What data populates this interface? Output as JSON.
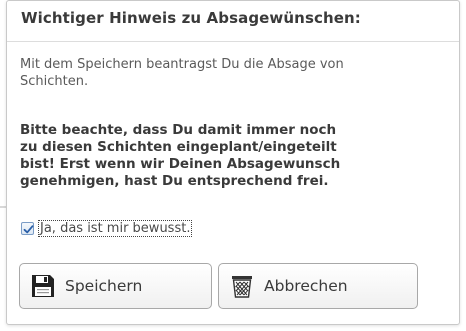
{
  "dialog": {
    "title": "Wichtiger Hinweis zu Absagewünschen:",
    "intro_line1": "Mit dem Speichern beantragst Du die Absage von",
    "intro_line2": "Schichten.",
    "warning_line1": "Bitte beachte, dass Du damit immer noch",
    "warning_line2": "zu diesen Schichten eingeplant/eingeteilt",
    "warning_line3": "bist! Erst wenn wir Deinen Absagewunsch",
    "warning_line4": "genehmigen, hast Du entsprechend frei.",
    "checkbox_label": "Ja, das ist mir bewusst.",
    "checkbox_checked": true,
    "save_label": "Speichern",
    "cancel_label": "Abbrechen"
  },
  "icons": {
    "save": "floppy-disk-icon",
    "cancel": "trash-bin-icon",
    "check": "checkmark-icon"
  },
  "colors": {
    "checkbox_border": "#7a9cc6",
    "check_mark": "#2a5fa8",
    "text": "#3a3a3a"
  }
}
